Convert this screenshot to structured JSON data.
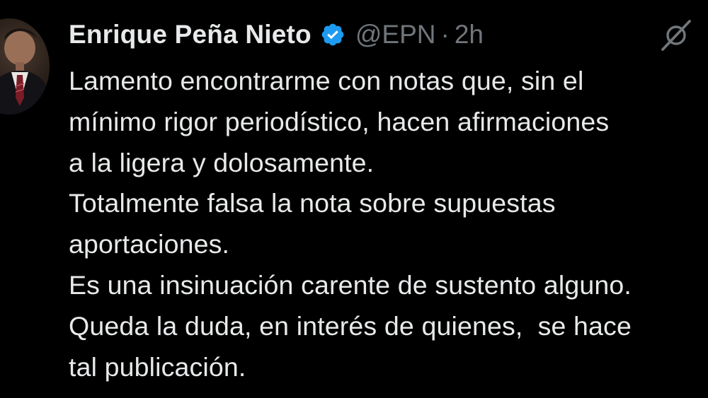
{
  "tweet": {
    "author": {
      "display_name": "Enrique Peña Nieto",
      "handle": "@EPN",
      "separator": "·",
      "time": "2h",
      "verified": true,
      "avatar_icon": "user-avatar"
    },
    "lines": [
      "Lamento encontrarme con notas que, sin el",
      "mínimo rigor periodístico, hacen afirmaciones",
      "a la ligera y dolosamente.",
      "Totalmente falsa la nota sobre supuestas",
      "aportaciones.",
      "Es una insinuación carente de sustento alguno.",
      "Queda la duda, en interés de quienes,  se hace",
      "tal publicación."
    ],
    "icons": {
      "verified": "verified-badge-icon",
      "more": "grok-slash-icon"
    }
  },
  "colors": {
    "background": "#000000",
    "primary_text": "#e7e9ea",
    "secondary_text": "#71767b",
    "verified_blue": "#1d9bf0"
  }
}
